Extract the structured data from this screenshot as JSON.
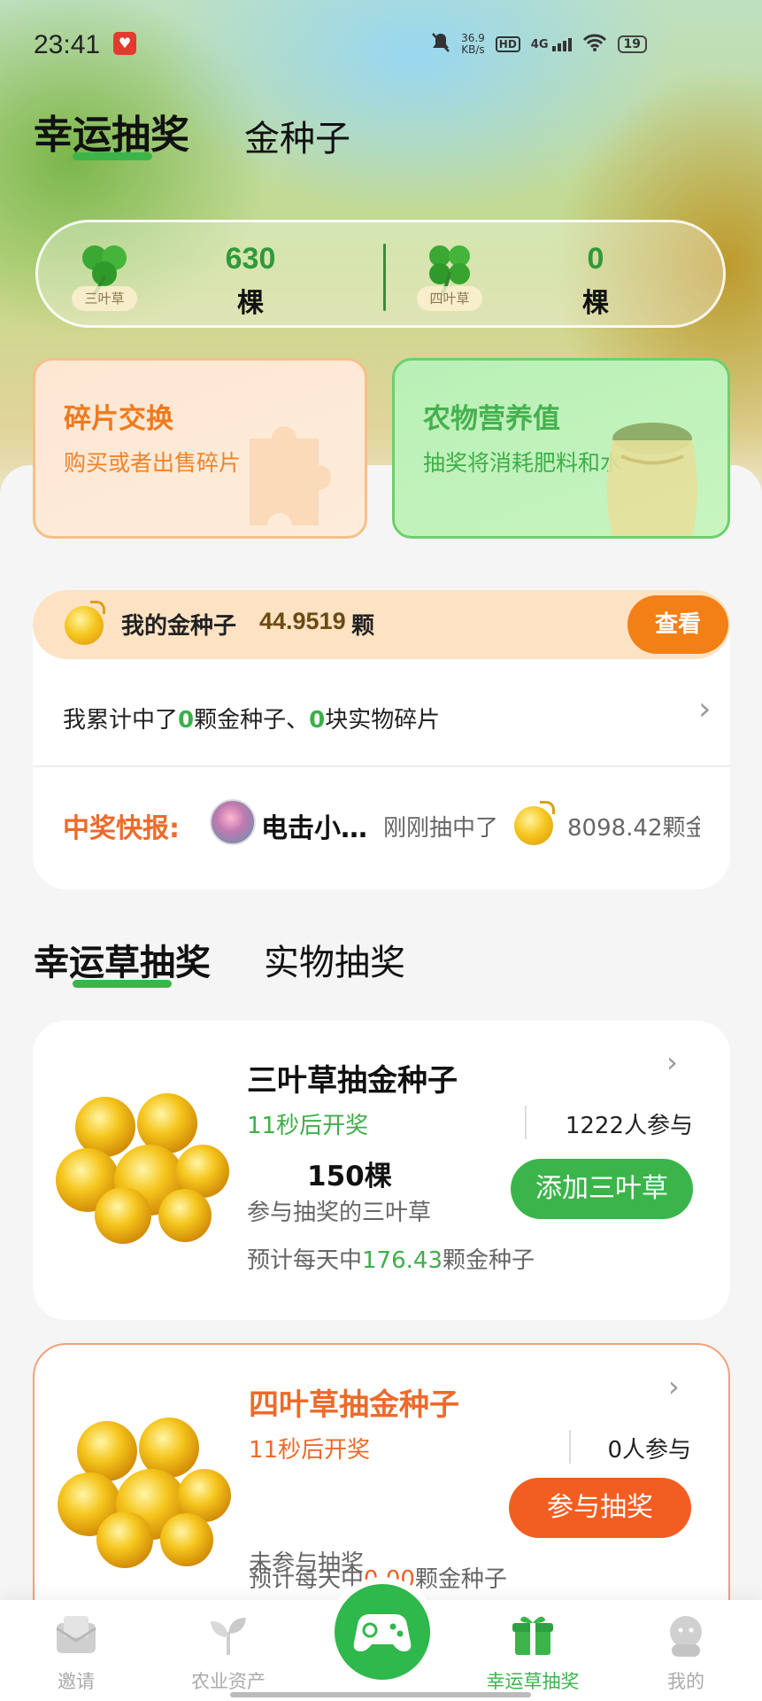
{
  "status_bar": {
    "time": "23:41",
    "net_speed_value": "36.9",
    "net_speed_unit": "KB/s",
    "hd": "HD",
    "network": "4G",
    "battery": "19"
  },
  "top_tabs": [
    {
      "label": "幸运抽奖",
      "active": true
    },
    {
      "label": "金种子",
      "active": false
    }
  ],
  "clover_card": {
    "three": {
      "name": "三叶草",
      "count": "630",
      "unit": "棵"
    },
    "four": {
      "name": "四叶草",
      "count": "0",
      "unit": "棵"
    }
  },
  "features": {
    "fragments": {
      "title": "碎片交换",
      "subtitle": "购买或者出售碎片"
    },
    "nutrition": {
      "title": "农物营养值",
      "subtitle": "抽奖将消耗肥料和水"
    }
  },
  "gold_seed": {
    "label": "我的金种子",
    "value": "44.9519",
    "unit": "颗",
    "view_button": "查看",
    "cumulative_prefix": "我累计中了",
    "cumulative_seeds": "0",
    "cumulative_mid": "颗金种子、",
    "cumulative_pieces": "0",
    "cumulative_suffix": "块实物碎片"
  },
  "winner_news": {
    "label": "中奖快报:",
    "name": "电击小…",
    "text": "刚刚抽中了",
    "amount": "8098.42颗金"
  },
  "section_tabs": [
    {
      "label": "幸运草抽奖",
      "active": true
    },
    {
      "label": "实物抽奖",
      "active": false
    }
  ],
  "lotteries": [
    {
      "title": "三叶草抽金种子",
      "countdown": "11秒后开奖",
      "participants": "1222人参与",
      "amount": "150棵",
      "amount_label": "参与抽奖的三叶草",
      "button": "添加三叶草",
      "estimate_prefix": "预计每天中",
      "estimate_value": "176.43",
      "estimate_suffix": "颗金种子"
    },
    {
      "title": "四叶草抽金种子",
      "countdown": "11秒后开奖",
      "participants": "0人参与",
      "status": "未参与抽奖",
      "button": "参与抽奖",
      "estimate_prefix": "预计每天中",
      "estimate_value": "0.00",
      "estimate_suffix": "颗金种子"
    }
  ],
  "bottom_nav": [
    {
      "label": "邀请",
      "icon": "envelope-icon"
    },
    {
      "label": "农业资产",
      "icon": "plant-icon"
    },
    {
      "label": "",
      "icon": "gamepad-icon"
    },
    {
      "label": "幸运草抽奖",
      "icon": "gift-icon",
      "active": true
    },
    {
      "label": "我的",
      "icon": "profile-icon"
    }
  ],
  "colors": {
    "accent_green": "#3bb54a",
    "accent_orange": "#f28016",
    "accent_red_orange": "#f25e22"
  }
}
